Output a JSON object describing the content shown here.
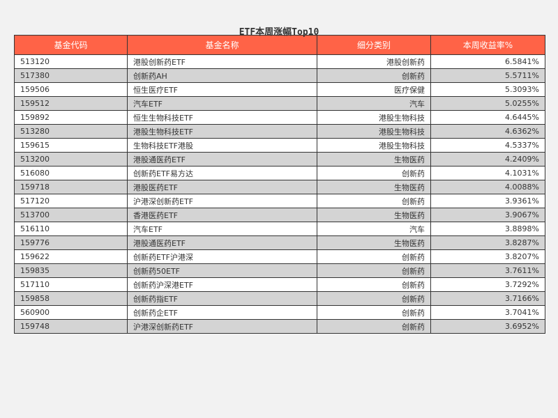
{
  "chart_data": {
    "type": "table",
    "title": "ETF本周涨幅Top10",
    "columns": [
      "基金代码",
      "基金名称",
      "细分类别",
      "本周收益率%"
    ],
    "rows": [
      [
        "513120",
        "港股创新药ETF",
        "港股创新药",
        "6.5841%"
      ],
      [
        "517380",
        "创新药AH",
        "创新药",
        "5.5711%"
      ],
      [
        "159506",
        "恒生医疗ETF",
        "医疗保健",
        "5.3093%"
      ],
      [
        "159512",
        "汽车ETF",
        "汽车",
        "5.0255%"
      ],
      [
        "159892",
        "恒生生物科技ETF",
        "港股生物科技",
        "4.6445%"
      ],
      [
        "513280",
        "港股生物科技ETF",
        "港股生物科技",
        "4.6362%"
      ],
      [
        "159615",
        "生物科技ETF港股",
        "港股生物科技",
        "4.5337%"
      ],
      [
        "513200",
        "港股通医药ETF",
        "生物医药",
        "4.2409%"
      ],
      [
        "516080",
        "创新药ETF易方达",
        "创新药",
        "4.1031%"
      ],
      [
        "159718",
        "港股医药ETF",
        "生物医药",
        "4.0088%"
      ],
      [
        "517120",
        "沪港深创新药ETF",
        "创新药",
        "3.9361%"
      ],
      [
        "513700",
        "香港医药ETF",
        "生物医药",
        "3.9067%"
      ],
      [
        "516110",
        "汽车ETF",
        "汽车",
        "3.8898%"
      ],
      [
        "159776",
        "港股通医药ETF",
        "生物医药",
        "3.8287%"
      ],
      [
        "159622",
        "创新药ETF沪港深",
        "创新药",
        "3.8207%"
      ],
      [
        "159835",
        "创新药50ETF",
        "创新药",
        "3.7611%"
      ],
      [
        "517110",
        "创新药沪深港ETF",
        "创新药",
        "3.7292%"
      ],
      [
        "159858",
        "创新药指ETF",
        "创新药",
        "3.7166%"
      ],
      [
        "560900",
        "创新药企ETF",
        "创新药",
        "3.7041%"
      ],
      [
        "159748",
        "沪港深创新药ETF",
        "创新药",
        "3.6952%"
      ]
    ],
    "header_color": "#ff6347",
    "row_colors": [
      "#ffffff",
      "#d4d4d4"
    ],
    "background_color": "#f2f2f2"
  }
}
